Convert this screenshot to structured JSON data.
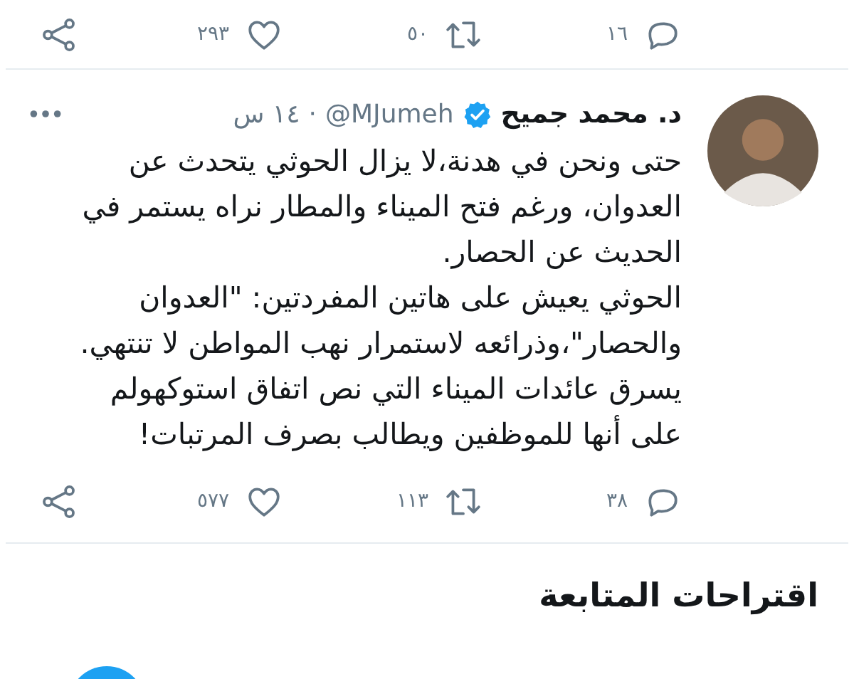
{
  "previous_tweet_actions": {
    "replies": "١٦",
    "retweets": "٥٠",
    "likes": "٢٩٣"
  },
  "tweet": {
    "author": "د. محمد جميح",
    "verified": true,
    "handle": "@MJumeh",
    "separator": "·",
    "time": "١٤ س",
    "text": "حتى ونحن في هدنة،لا يزال الحوثي يتحدث عن العدوان، ورغم فتح الميناء والمطار نراه يستمر في الحديث عن الحصار.\nالحوثي يعيش على هاتين المفردتين: \"العدوان والحصار\"،وذرائعه لاستمرار نهب المواطن لا تنتهي.\nيسرق عائدات الميناء التي نص اتفاق استوكهولم على أنها للموظفين ويطالب بصرف المرتبات!",
    "actions": {
      "replies": "٣٨",
      "retweets": "١١٣",
      "likes": "٥٧٧"
    }
  },
  "suggestions": {
    "title": "اقتراحات المتابعة"
  }
}
